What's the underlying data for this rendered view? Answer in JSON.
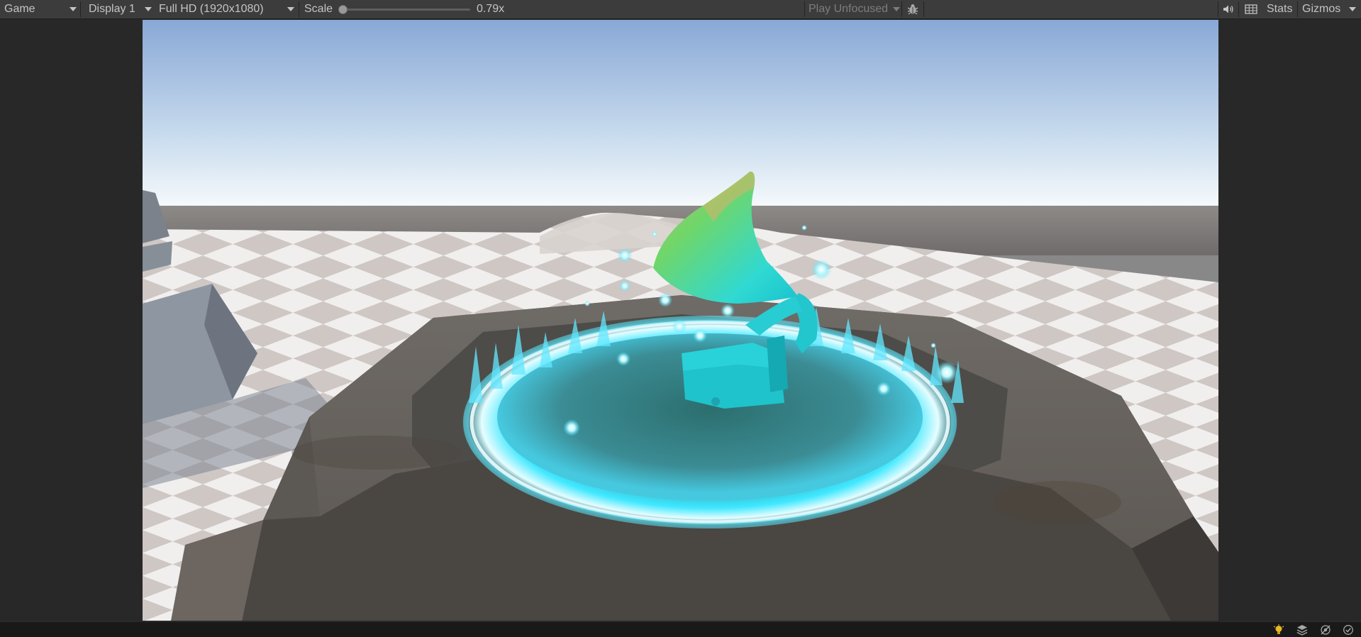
{
  "toolbar": {
    "view_dropdown": "Game",
    "display_dropdown": "Display 1",
    "resolution_dropdown": "Full HD (1920x1080)",
    "scale_label": "Scale",
    "scale_value": "0.79x",
    "scale_fraction": 0.0,
    "play_mode_dropdown": "Play Unfocused",
    "stats_button": "Stats",
    "gizmos_button": "Gizmos"
  },
  "icons": {
    "bug": "bug-icon",
    "audio": "speaker-icon",
    "grid": "grid-icon",
    "status": [
      "lightbulb-icon",
      "layers-icon",
      "no-network-icon",
      "check-circle-icon"
    ]
  },
  "colors": {
    "toolbar_bg": "#3c3c3c",
    "panel_bg": "#282828",
    "status_bg": "#191919",
    "accent_glow": "#3fe6ff",
    "sky_top": "#8aaad8",
    "checker_light": "#f2f1f0",
    "checker_dark": "#cfc9c6"
  }
}
